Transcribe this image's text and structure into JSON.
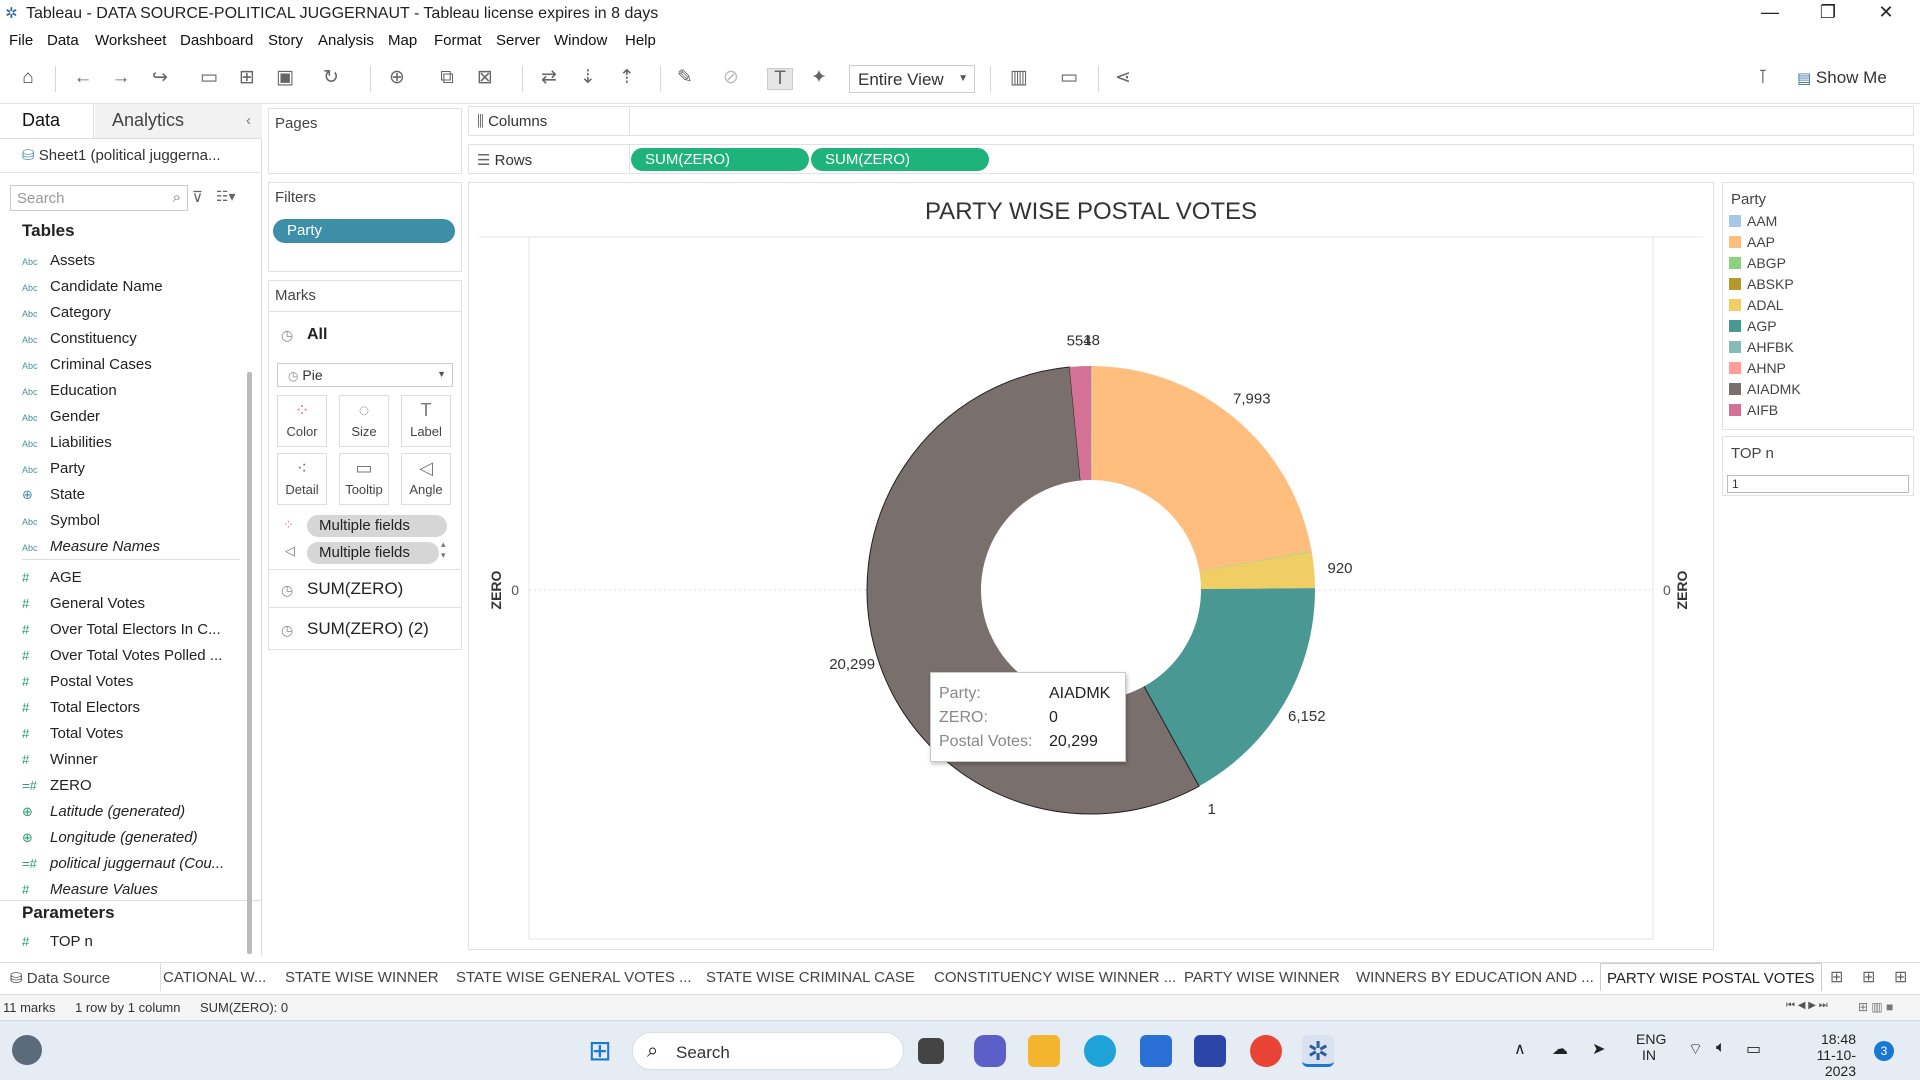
{
  "window": {
    "title": "Tableau - DATA SOURCE-POLITICAL JUGGERNAUT - Tableau license expires in 8 days",
    "minimize": "—",
    "restore": "❐",
    "close": "✕"
  },
  "menu": [
    "File",
    "Data",
    "Worksheet",
    "Dashboard",
    "Story",
    "Analysis",
    "Map",
    "Format",
    "Server",
    "Window",
    "Help"
  ],
  "toolbar": {
    "view_mode": "Entire View",
    "show_me": "Show Me"
  },
  "data_pane": {
    "tabs": [
      "Data",
      "Analytics"
    ],
    "data_source": "Sheet1 (political juggerna...",
    "search_placeholder": "Search",
    "tables_heading": "Tables",
    "dimensions": [
      {
        "type": "Abc",
        "name": "Assets"
      },
      {
        "type": "Abc",
        "name": "Candidate Name"
      },
      {
        "type": "Abc",
        "name": "Category"
      },
      {
        "type": "Abc",
        "name": "Constituency"
      },
      {
        "type": "Abc",
        "name": "Criminal Cases"
      },
      {
        "type": "Abc",
        "name": "Education"
      },
      {
        "type": "Abc",
        "name": "Gender"
      },
      {
        "type": "Abc",
        "name": "Liabilities"
      },
      {
        "type": "Abc",
        "name": "Party"
      },
      {
        "type": "⊕",
        "name": "State"
      },
      {
        "type": "Abc",
        "name": "Symbol"
      },
      {
        "type": "Abc",
        "name": "Measure Names"
      }
    ],
    "measures": [
      {
        "type": "#",
        "name": "AGE"
      },
      {
        "type": "#",
        "name": "General Votes"
      },
      {
        "type": "#",
        "name": "Over Total Electors  In C..."
      },
      {
        "type": "#",
        "name": "Over Total Votes Polled  ..."
      },
      {
        "type": "#",
        "name": "Postal Votes"
      },
      {
        "type": "#",
        "name": "Total Electors"
      },
      {
        "type": "#",
        "name": "Total Votes"
      },
      {
        "type": "#",
        "name": "Winner"
      },
      {
        "type": "=#",
        "name": "ZERO"
      },
      {
        "type": "⊕",
        "name": "Latitude (generated)"
      },
      {
        "type": "⊕",
        "name": "Longitude (generated)"
      },
      {
        "type": "=#",
        "name": "political juggernaut (Cou..."
      },
      {
        "type": "#",
        "name": "Measure Values"
      }
    ],
    "parameters_heading": "Parameters",
    "parameters": [
      {
        "type": "#",
        "name": "TOP n"
      }
    ]
  },
  "pages_card": {
    "title": "Pages"
  },
  "filters_card": {
    "title": "Filters",
    "pill": "Party"
  },
  "marks_card": {
    "title": "Marks",
    "all": "All",
    "mark_type": "Pie",
    "buttons": [
      "Color",
      "Size",
      "Label",
      "Detail",
      "Tooltip",
      "Angle"
    ],
    "pills": [
      "Multiple fields",
      "Multiple fields"
    ],
    "layers": [
      "SUM(ZERO)",
      "SUM(ZERO) (2)"
    ]
  },
  "shelves": {
    "columns_label": "Columns",
    "rows_label": "Rows",
    "rows_pills": [
      "SUM(ZERO)",
      "SUM(ZERO)"
    ]
  },
  "legend": {
    "title": "Party",
    "items": [
      {
        "name": "AAM",
        "color": "#a4c8e6"
      },
      {
        "name": "AAP",
        "color": "#ffbe7d"
      },
      {
        "name": "ABGP",
        "color": "#8cd17d"
      },
      {
        "name": "ABSKP",
        "color": "#b6992d"
      },
      {
        "name": "ADAL",
        "color": "#f1ce63"
      },
      {
        "name": "AGP",
        "color": "#499894"
      },
      {
        "name": "AHFBK",
        "color": "#86bcb6"
      },
      {
        "name": "AHNP",
        "color": "#ff9d9a"
      },
      {
        "name": "AIADMK",
        "color": "#79706e"
      },
      {
        "name": "AIFB",
        "color": "#d37295"
      }
    ]
  },
  "topn": {
    "title": "TOP n",
    "value": "1"
  },
  "chart_data": {
    "type": "pie",
    "title": "PARTY WISE POSTAL VOTES",
    "ylabel_left": "ZERO",
    "ylabel_right": "ZERO",
    "y_tick_left": "0",
    "y_tick_right": "0",
    "slices": [
      {
        "party": "AAP",
        "value": 7993,
        "label": "7,993",
        "color": "#ffbe7d"
      },
      {
        "party": "ABGP",
        "value": 0,
        "label": "",
        "color": "#8cd17d"
      },
      {
        "party": "ADAL",
        "value": 920,
        "label": "920",
        "color": "#f1ce63"
      },
      {
        "party": "AGP",
        "value": 6152,
        "label": "6,152",
        "color": "#499894"
      },
      {
        "party": "AHFBK",
        "value": 1,
        "label": "1",
        "color": "#86bcb6"
      },
      {
        "party": "AIADMK",
        "value": 20299,
        "label": "20,299",
        "color": "#79706e"
      },
      {
        "party": "AIFB",
        "value": 554,
        "label": "554",
        "color": "#d37295"
      },
      {
        "party": "AAM",
        "value": 18,
        "label": "18",
        "color": "#a4c8e6"
      }
    ]
  },
  "tooltip": {
    "party_label": "Party:",
    "party_value": "AIADMK",
    "zero_label": "ZERO:",
    "zero_value": "0",
    "postal_label": "Postal Votes:",
    "postal_value": "20,299"
  },
  "sheet_tabs": {
    "data_source": "Data Source",
    "tabs": [
      "CATIONAL W...",
      "STATE WISE WINNER",
      "STATE WISE GENERAL VOTES ...",
      "STATE WISE CRIMINAL CASE",
      "CONSTITUENCY WISE WINNER ...",
      "PARTY WISE WINNER",
      "WINNERS BY EDUCATION AND ...",
      "PARTY WISE POSTAL VOTES"
    ]
  },
  "status": {
    "marks": "11 marks",
    "rows": "1 row by 1 column",
    "sum": "SUM(ZERO): 0"
  },
  "taskbar": {
    "search": "Search",
    "lang": "ENG",
    "region": "IN",
    "time": "18:48",
    "date": "11-10-2023",
    "notif": "3"
  }
}
